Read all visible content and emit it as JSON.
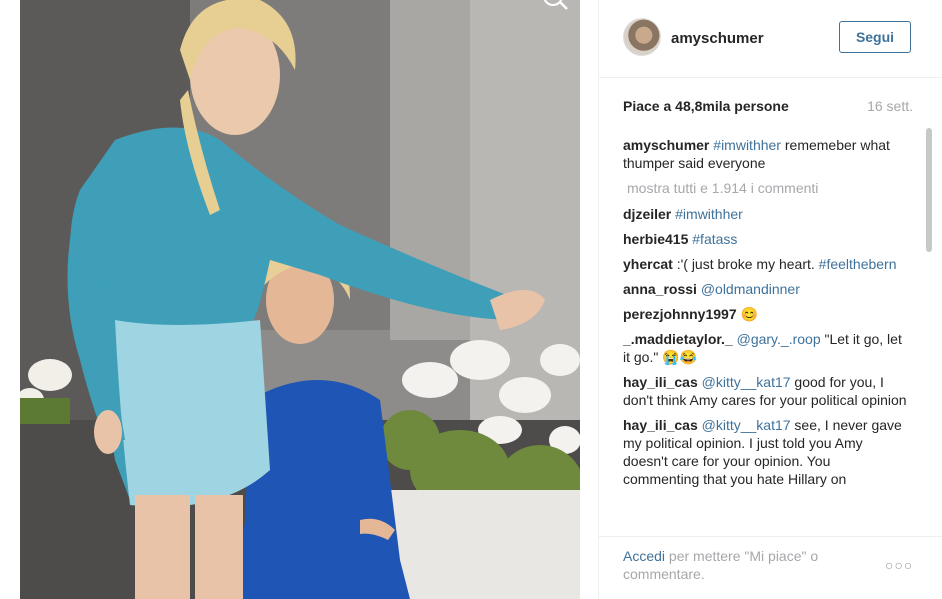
{
  "post": {
    "username": "amyschumer",
    "follow_label": "Segui",
    "likes": "Piace a 48,8mila persone",
    "time_ago": "16 sett."
  },
  "caption": {
    "user": "amyschumer",
    "tag": "#imwithher",
    "text": " rememeber what thumper said everyone"
  },
  "show_all_label": "mostra tutti e 1.914 i commenti",
  "comments": [
    {
      "user": "djzeiler",
      "tag": " #imwithher",
      "text": ""
    },
    {
      "user": "herbie415",
      "tag": " #fatass",
      "text": ""
    },
    {
      "user": "yhercat",
      "tag": "",
      "text": " :'( just broke my heart. ",
      "tag2": "#feelthebern"
    },
    {
      "user": "anna_rossi",
      "tag": " @oldmandinner",
      "text": ""
    },
    {
      "user": "perezjohnny1997",
      "tag": "",
      "text": " 😊"
    },
    {
      "user": "_.maddietaylor._",
      "tag": " @gary._.roop",
      "text": " \"Let it go, let it go.\" 😭😂"
    },
    {
      "user": "hay_ili_cas",
      "tag": " @kitty__kat17",
      "text": " good for you, I don't think Amy cares for your political opinion"
    },
    {
      "user": "hay_ili_cas",
      "tag": " @kitty__kat17",
      "text": " see, I never gave my political opinion. I just told you Amy doesn't care for your opinion. You commenting that you hate Hillary on"
    }
  ],
  "footer": {
    "login_label": "Accedi",
    "rest": " per mettere \"Mi piace\" o commentare.",
    "more_icon": "more-dots-icon"
  },
  "colors": {
    "link": "#3f729b",
    "muted": "#a5a7aa",
    "text": "#262626"
  }
}
